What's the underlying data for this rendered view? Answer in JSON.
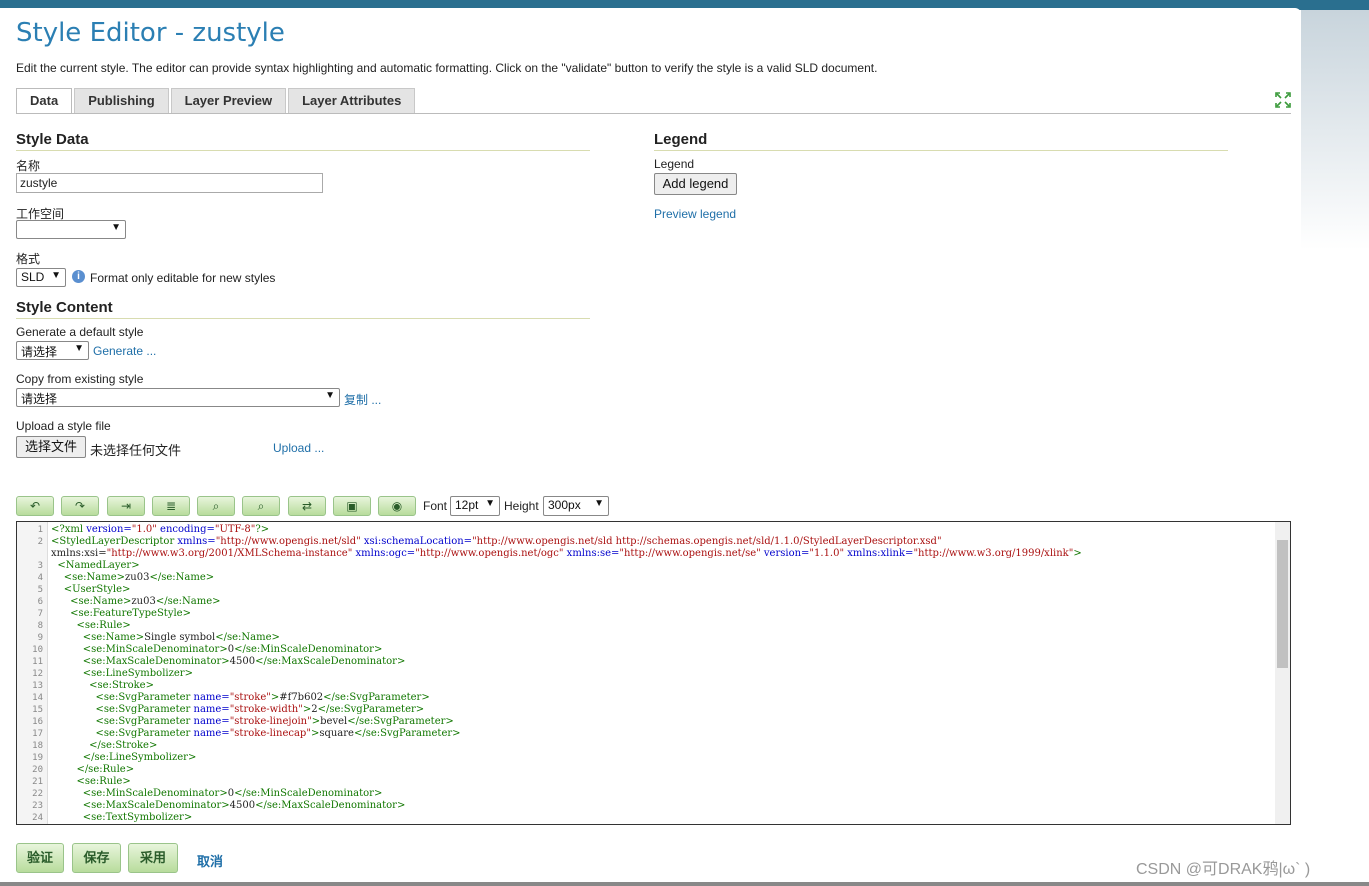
{
  "page": {
    "title": "Style Editor - zustyle",
    "description": "Edit the current style. The editor can provide syntax highlighting and automatic formatting. Click on the \"validate\" button to verify the style is a valid SLD document."
  },
  "tabs": [
    "Data",
    "Publishing",
    "Layer Preview",
    "Layer Attributes"
  ],
  "style_data": {
    "heading": "Style Data",
    "name_label": "名称",
    "name_value": "zustyle",
    "workspace_label": "工作空间",
    "workspace_value": "",
    "format_label": "格式",
    "format_value": "SLD",
    "format_note": "Format only editable for new styles"
  },
  "legend": {
    "heading": "Legend",
    "label": "Legend",
    "add_button": "Add legend",
    "preview_link": "Preview legend"
  },
  "style_content": {
    "heading": "Style Content",
    "generate_label": "Generate a default style",
    "generate_select": "请选择",
    "generate_link": "Generate ...",
    "copy_label": "Copy from existing style",
    "copy_select": "请选择",
    "copy_link": "复制 ...",
    "upload_label": "Upload a style file",
    "choose_file_button": "选择文件",
    "no_file_text": "未选择任何文件",
    "upload_link": "Upload ..."
  },
  "toolbar": {
    "font_label": "Font",
    "font_value": "12pt",
    "height_label": "Height",
    "height_value": "300px"
  },
  "code_lines": [
    {
      "n": "1",
      "text": "<?xml version=\"1.0\" encoding=\"UTF-8\"?>"
    },
    {
      "n": "2",
      "text": "<StyledLayerDescriptor xmlns=\"http://www.opengis.net/sld\" xsi:schemaLocation=\"http://www.opengis.net/sld http://schemas.opengis.net/sld/1.1.0/StyledLayerDescriptor.xsd\""
    },
    {
      "n": "",
      "text": "xmlns:xsi=\"http://www.w3.org/2001/XMLSchema-instance\" xmlns:ogc=\"http://www.opengis.net/ogc\" xmlns:se=\"http://www.opengis.net/se\" version=\"1.1.0\" xmlns:xlink=\"http://www.w3.org/1999/xlink\">"
    },
    {
      "n": "3",
      "text": "  <NamedLayer>"
    },
    {
      "n": "4",
      "text": "    <se:Name>zu03</se:Name>"
    },
    {
      "n": "5",
      "text": "    <UserStyle>"
    },
    {
      "n": "6",
      "text": "      <se:Name>zu03</se:Name>"
    },
    {
      "n": "7",
      "text": "      <se:FeatureTypeStyle>"
    },
    {
      "n": "8",
      "text": "        <se:Rule>"
    },
    {
      "n": "9",
      "text": "          <se:Name>Single symbol</se:Name>"
    },
    {
      "n": "10",
      "text": "          <se:MinScaleDenominator>0</se:MinScaleDenominator>"
    },
    {
      "n": "11",
      "text": "          <se:MaxScaleDenominator>4500</se:MaxScaleDenominator>"
    },
    {
      "n": "12",
      "text": "          <se:LineSymbolizer>"
    },
    {
      "n": "13",
      "text": "            <se:Stroke>"
    },
    {
      "n": "14",
      "text": "              <se:SvgParameter name=\"stroke\">#f7b602</se:SvgParameter>"
    },
    {
      "n": "15",
      "text": "              <se:SvgParameter name=\"stroke-width\">2</se:SvgParameter>"
    },
    {
      "n": "16",
      "text": "              <se:SvgParameter name=\"stroke-linejoin\">bevel</se:SvgParameter>"
    },
    {
      "n": "17",
      "text": "              <se:SvgParameter name=\"stroke-linecap\">square</se:SvgParameter>"
    },
    {
      "n": "18",
      "text": "            </se:Stroke>"
    },
    {
      "n": "19",
      "text": "          </se:LineSymbolizer>"
    },
    {
      "n": "20",
      "text": "        </se:Rule>"
    },
    {
      "n": "21",
      "text": "        <se:Rule>"
    },
    {
      "n": "22",
      "text": "          <se:MinScaleDenominator>0</se:MinScaleDenominator>"
    },
    {
      "n": "23",
      "text": "          <se:MaxScaleDenominator>4500</se:MaxScaleDenominator>"
    },
    {
      "n": "24",
      "text": "          <se:TextSymbolizer>"
    }
  ],
  "actions": {
    "validate": "验证",
    "save": "保存",
    "apply": "采用",
    "cancel": "取消"
  },
  "watermark": "CSDN @可DRAK鸦|ω` )"
}
